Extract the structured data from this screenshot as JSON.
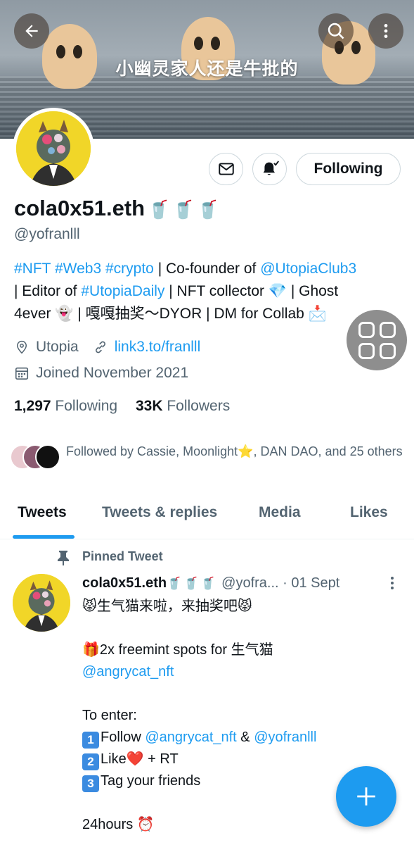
{
  "banner": {
    "title": "小幽灵家人还是牛批的"
  },
  "header": {
    "back_icon": "arrow-left-icon",
    "search_icon": "search-icon",
    "more_icon": "more-vertical-icon"
  },
  "profile": {
    "name": "cola0x51.eth",
    "name_emoji": "🥤🥤🥤",
    "handle": "@yofranlll",
    "following_button": "Following",
    "bio": {
      "tag1": "#NFT",
      "tag2": "#Web3",
      "tag3": "#crypto",
      "text1": " | Co-founder of ",
      "mention1": "@UtopiaClub3",
      "text2": "| Editor of ",
      "tag4": "#UtopiaDaily",
      "text3": " | NFT collector 💎 | Ghost",
      "text4": "4ever 👻 | 嘎嘎抽奖～DYOR | DM for Collab 📩"
    },
    "location": "Utopia",
    "website": "link3.to/franlll",
    "joined": "Joined November 2021",
    "following_count": "1,297",
    "following_label": "Following",
    "followers_count": "33K",
    "followers_label": "Followers",
    "followed_by": "Followed by Cassie, Moonlight⭐, DAN DAO, and 25 others"
  },
  "tabs": {
    "tweets": "Tweets",
    "replies": "Tweets & replies",
    "media": "Media",
    "likes": "Likes"
  },
  "tweet": {
    "pinned_label": "Pinned Tweet",
    "name": "cola0x51.eth",
    "name_emoji": "🥤🥤🥤",
    "handle": "@yofra...",
    "date": "· 01 Sept",
    "line1": "😾生气猫来啦，来抽奖吧😾",
    "line2a": "🎁2x freemint spots for 生气猫",
    "line2b": "@angrycat_nft",
    "line3": "To enter:",
    "step1_num": "1",
    "step1_text": "Follow ",
    "step1_mention1": "@angrycat_nft",
    "step1_and": " & ",
    "step1_mention2": "@yofranlll",
    "step2_num": "2",
    "step2_text": "Like❤️ + RT",
    "step3_num": "3",
    "step3_text": "Tag your friends",
    "line4": "24hours ⏰"
  },
  "colors": {
    "accent": "#1d9bf0",
    "text_primary": "#0f1419",
    "text_secondary": "#536471"
  }
}
